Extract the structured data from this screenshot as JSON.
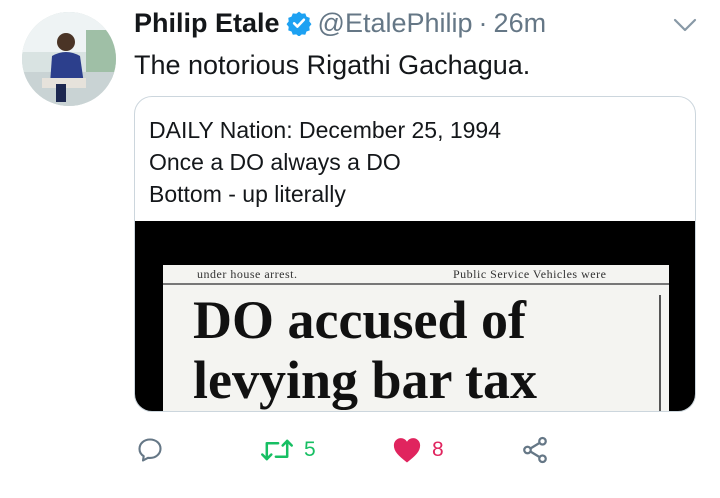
{
  "author": {
    "name": "Philip Etale",
    "handle": "@EtalePhilip",
    "separator": "·",
    "time": "26m"
  },
  "tweet": {
    "text": "The notorious Rigathi Gachagua."
  },
  "quote": {
    "lines": [
      "DAILY Nation: December 25, 1994",
      "Once a DO always a DO",
      "Bottom - up literally"
    ],
    "clipping": {
      "top_left_text": "under house arrest.",
      "top_right_text": "Public Service Vehicles were",
      "headline_line1": "DO accused of",
      "headline_line2": "levying bar tax"
    }
  },
  "actions": {
    "reply_icon": "reply-icon",
    "retweet_icon": "retweet-icon",
    "retweet_count": "5",
    "like_icon": "heart-icon",
    "like_count": "8",
    "share_icon": "share-icon"
  },
  "colors": {
    "retweet": "#17bf63",
    "like": "#e0245e",
    "verified": "#1da1f2",
    "secondary": "#657786"
  }
}
